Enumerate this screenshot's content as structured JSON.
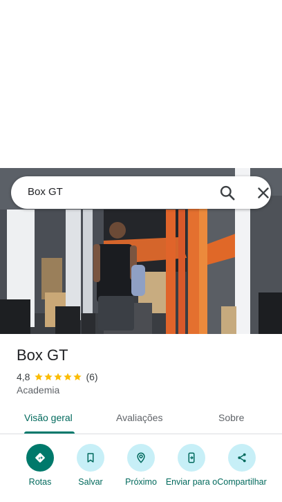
{
  "search": {
    "query": "Box GT"
  },
  "place": {
    "name": "Box GT",
    "rating": "4,8",
    "review_count": "(6)",
    "stars": 5,
    "category": "Academia"
  },
  "tabs": [
    {
      "label": "Visão geral",
      "active": true
    },
    {
      "label": "Avaliações",
      "active": false
    },
    {
      "label": "Sobre",
      "active": false
    }
  ],
  "actions": [
    {
      "label": "Rotas",
      "icon": "directions-icon"
    },
    {
      "label": "Salvar",
      "icon": "bookmark-icon"
    },
    {
      "label": "Próximo",
      "icon": "nearby-icon"
    },
    {
      "label": "Enviar para o",
      "icon": "send-to-phone-icon"
    },
    {
      "label": "Compartilhar",
      "icon": "share-icon"
    }
  ],
  "colors": {
    "accent": "#00796b",
    "action_bg": "#c7eff7",
    "star": "#fbbc04",
    "gym_orange": "#e0642a"
  }
}
